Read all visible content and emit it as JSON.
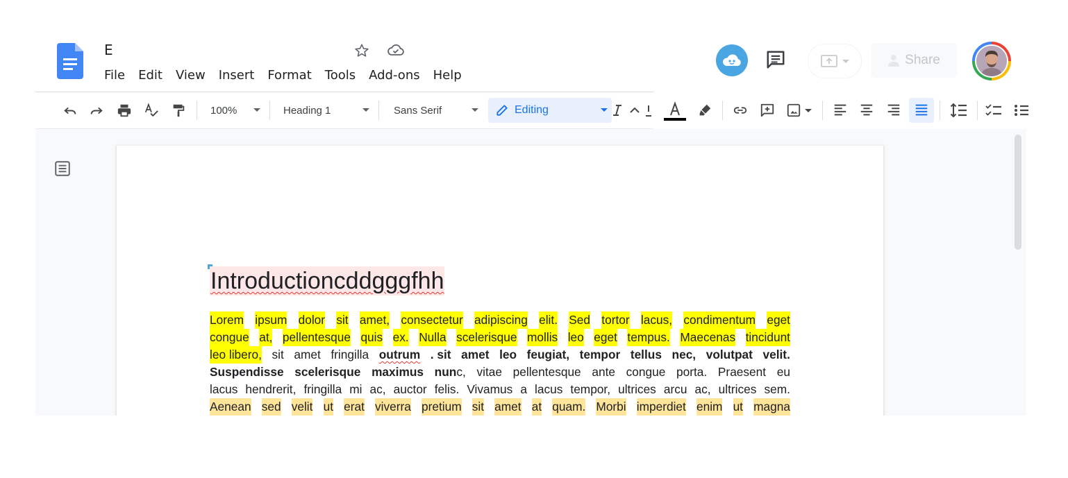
{
  "app": {
    "doc_title": "E",
    "logo_icon": "google-docs-logo",
    "title_icons": [
      "star-icon",
      "cloud-saved-icon"
    ]
  },
  "menu": [
    "File",
    "Edit",
    "View",
    "Insert",
    "Format",
    "Tools",
    "Add-ons",
    "Help"
  ],
  "header_actions": {
    "addon_icon": "addon-cloud-icon",
    "comment_icon": "comment-history-icon",
    "present_icon": "present-icon",
    "share_label": "Share",
    "avatar_icon": "user-avatar"
  },
  "toolbar": {
    "zoom": "100%",
    "style": "Heading 1",
    "font": "Sans Serif",
    "mode": "Editing",
    "icons": [
      "undo-icon",
      "redo-icon",
      "print-icon",
      "spellcheck-icon",
      "paint-format-icon",
      "italic-icon",
      "caret-icon",
      "underline-icon",
      "text-color-icon",
      "highlight-icon",
      "link-icon",
      "add-comment-icon",
      "insert-image-icon",
      "align-left-icon",
      "align-center-icon",
      "align-right-icon",
      "justify-icon",
      "line-spacing-icon",
      "checklist-icon",
      "bulleted-list-icon"
    ],
    "accent": "#1a73e8"
  },
  "document": {
    "heading": "Introductioncddgggfhh",
    "lines": [
      [
        {
          "t": "Lorem",
          "s": "y"
        },
        {
          "t": "ipsum",
          "s": "y"
        },
        {
          "t": "dolor",
          "s": "y"
        },
        {
          "t": "sit",
          "s": "y"
        },
        {
          "t": "amet,",
          "s": "y"
        },
        {
          "t": "consectetur",
          "s": "y"
        },
        {
          "t": "adipiscing",
          "s": "y"
        },
        {
          "t": "elit.",
          "s": "y"
        },
        {
          "t": "Sed",
          "s": "y"
        },
        {
          "t": "tortor",
          "s": "y"
        },
        {
          "t": "lacus,",
          "s": "y"
        },
        {
          "t": "condimentum",
          "s": "y"
        },
        {
          "t": "eget",
          "s": "y"
        }
      ],
      [
        {
          "t": "congue",
          "s": "y"
        },
        {
          "t": "at,",
          "s": "y"
        },
        {
          "t": "pellentesque",
          "s": "y"
        },
        {
          "t": "quis",
          "s": "y"
        },
        {
          "t": "ex.",
          "s": "y"
        },
        {
          "t": "Nulla",
          "s": "y"
        },
        {
          "t": "scelerisque",
          "s": "y"
        },
        {
          "t": "mollis",
          "s": "y"
        },
        {
          "t": "leo",
          "s": "y"
        },
        {
          "t": "eget",
          "s": "y"
        },
        {
          "t": "tempus.",
          "s": "y"
        },
        {
          "t": "Maecenas",
          "s": "y"
        },
        {
          "t": "tincidunt",
          "s": "y"
        }
      ],
      [
        {
          "t": "leo libero,",
          "s": "y"
        },
        {
          "t": "sit",
          "s": ""
        },
        {
          "t": "amet",
          "s": ""
        },
        {
          "t": "fringilla",
          "s": ""
        },
        {
          "t": "outrum",
          "s": "bs"
        },
        {
          "t": ". sit",
          "s": "b"
        },
        {
          "t": "amet",
          "s": "b"
        },
        {
          "t": "leo",
          "s": "b"
        },
        {
          "t": "feugiat,",
          "s": "b"
        },
        {
          "t": "tempor",
          "s": "b"
        },
        {
          "t": "tellus",
          "s": "b"
        },
        {
          "t": "nec,",
          "s": "b"
        },
        {
          "t": "volutpat",
          "s": "b"
        },
        {
          "t": "velit.",
          "s": "b"
        }
      ],
      [
        {
          "t": "Suspendisse",
          "s": "b"
        },
        {
          "t": "scelerisque",
          "s": "b"
        },
        {
          "t": "maximus",
          "s": "b"
        },
        {
          "t": "nun",
          "s": "b",
          "join": "c,"
        },
        {
          "t": "vitae",
          "s": ""
        },
        {
          "t": "pellentesque",
          "s": ""
        },
        {
          "t": "ante",
          "s": ""
        },
        {
          "t": "congue",
          "s": ""
        },
        {
          "t": "porta.",
          "s": ""
        },
        {
          "t": "Praesent",
          "s": ""
        },
        {
          "t": "eu",
          "s": ""
        }
      ],
      [
        {
          "t": "lacus",
          "s": ""
        },
        {
          "t": "hendrerit,",
          "s": ""
        },
        {
          "t": "fringilla",
          "s": ""
        },
        {
          "t": "mi",
          "s": ""
        },
        {
          "t": "ac,",
          "s": ""
        },
        {
          "t": "auctor",
          "s": ""
        },
        {
          "t": "felis.",
          "s": ""
        },
        {
          "t": "Vivamus",
          "s": ""
        },
        {
          "t": "a",
          "s": ""
        },
        {
          "t": "lacus",
          "s": ""
        },
        {
          "t": "tempor,",
          "s": ""
        },
        {
          "t": "ultrices",
          "s": ""
        },
        {
          "t": "arcu",
          "s": ""
        },
        {
          "t": "ac,",
          "s": ""
        },
        {
          "t": "ultrices",
          "s": ""
        },
        {
          "t": "sem.",
          "s": ""
        }
      ],
      [
        {
          "t": "Aenean",
          "s": "o"
        },
        {
          "t": "sed",
          "s": "o"
        },
        {
          "t": "velit",
          "s": "o"
        },
        {
          "t": "ut",
          "s": "o"
        },
        {
          "t": "erat",
          "s": "o"
        },
        {
          "t": "viverra",
          "s": "o"
        },
        {
          "t": "pretium",
          "s": "o"
        },
        {
          "t": "sit",
          "s": "o"
        },
        {
          "t": "amet",
          "s": "o"
        },
        {
          "t": "at",
          "s": "o"
        },
        {
          "t": "quam.",
          "s": "o"
        },
        {
          "t": "Morbi",
          "s": "o"
        },
        {
          "t": "imperdiet",
          "s": "o"
        },
        {
          "t": "enim",
          "s": "o"
        },
        {
          "t": "ut",
          "s": "o"
        },
        {
          "t": "magna",
          "s": "o"
        }
      ]
    ],
    "highlight_colors": {
      "yellow": "#ffff00",
      "orange": "#ffe599",
      "heading": "#fde7e7"
    }
  }
}
